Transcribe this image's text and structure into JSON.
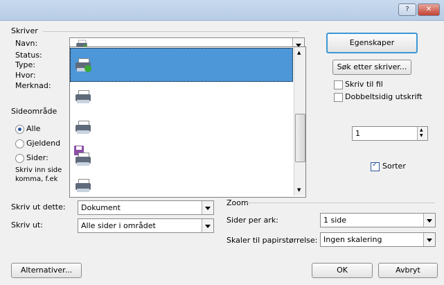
{
  "titlebar": {
    "help_glyph": "?",
    "close_glyph": "✕"
  },
  "printer_group": {
    "title": "Skriver",
    "name_label": "Navn:",
    "status_label": "Status:",
    "type_label": "Type:",
    "where_label": "Hvor:",
    "comment_label": "Merknad:",
    "properties_button": "Egenskaper",
    "find_printer_button": "Søk etter skriver...",
    "print_to_file_label": "Skriv til fil",
    "duplex_label": "Dobbeltsidig utskrift"
  },
  "range_group": {
    "title": "Sideområde",
    "all_label": "Alle",
    "current_label": "Gjeldend",
    "pages_label": "Sider:",
    "hint_line1": "Skriv inn side",
    "hint_line2": "komma, f.ek"
  },
  "copies": {
    "value": "1",
    "collate_label": "Sorter"
  },
  "zoom_group": {
    "title": "Zoom",
    "per_sheet_label": "Sider per ark:",
    "per_sheet_value": "1 side",
    "scale_label": "Skaler til papirstørrelse:",
    "scale_value": "Ingen skalering"
  },
  "print_what": {
    "label": "Skriv ut dette:",
    "value": "Dokument"
  },
  "print_mode": {
    "label": "Skriv ut:",
    "value": "Alle sider i området"
  },
  "footer": {
    "options_button": "Alternativer...",
    "ok_button": "OK",
    "cancel_button": "Avbryt"
  },
  "colors": {
    "selection": "#4d96d8",
    "focus_border": "#3c97d6",
    "titlebar": "#c9daee",
    "close": "#c24333"
  }
}
